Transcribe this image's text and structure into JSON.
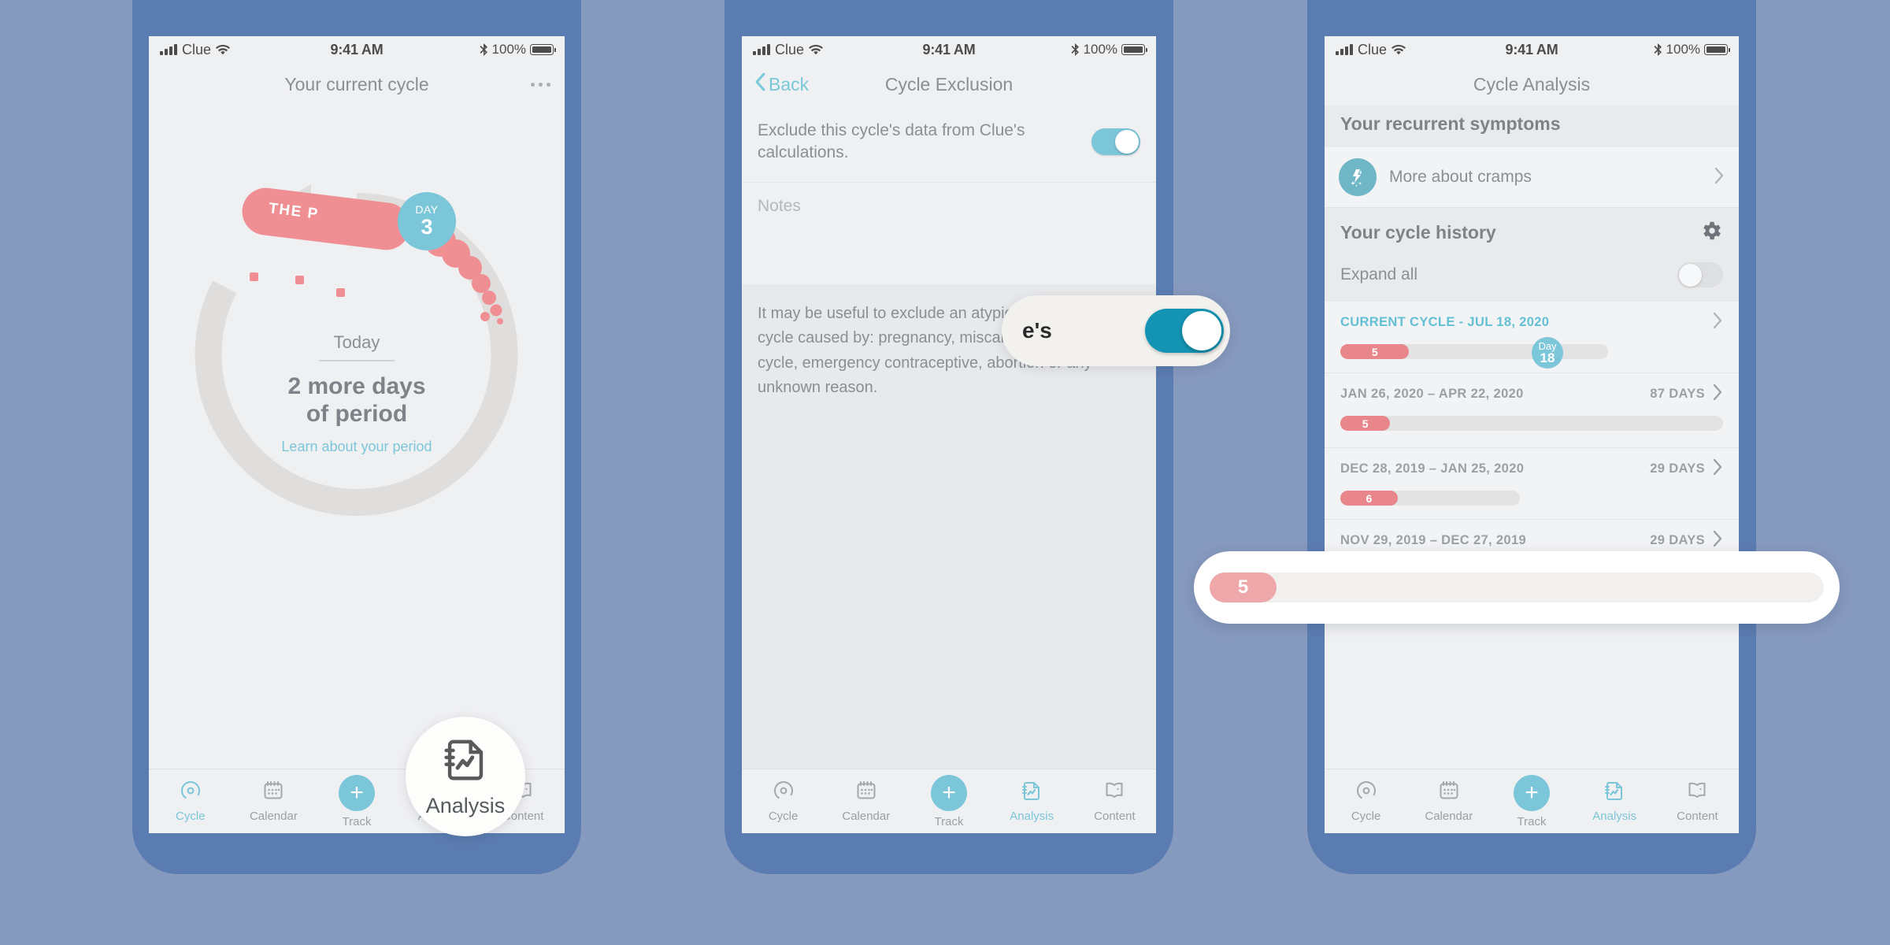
{
  "theme": {
    "background": "#8699be",
    "phone_frame": "#5b7cb0",
    "screen_bg": "#eff0f2",
    "accent_teal": "#7cc6d9",
    "accent_teal_dark": "#1494b4",
    "period_pink": "#e8868c",
    "text_grey": "#8a8f94"
  },
  "status_bar": {
    "carrier": "Clue",
    "time": "9:41 AM",
    "battery_percent": "100%",
    "signal_icon": "signal-bars-icon",
    "wifi_icon": "wifi-icon",
    "bluetooth_icon": "bluetooth-icon",
    "battery_icon": "battery-full-icon"
  },
  "tabbar": {
    "items": [
      {
        "label": "Cycle",
        "icon": "cycle-icon",
        "active_p1": true,
        "active_p2": false,
        "active_p3": false
      },
      {
        "label": "Calendar",
        "icon": "calendar-icon",
        "active_p1": false,
        "active_p2": false,
        "active_p3": false
      },
      {
        "label": "Track",
        "icon": "plus-icon",
        "active_p1": false,
        "active_p2": false,
        "active_p3": false
      },
      {
        "label": "Analysis",
        "icon": "analysis-icon",
        "active_p1": false,
        "active_p2": true,
        "active_p3": true
      },
      {
        "label": "Content",
        "icon": "content-icon",
        "active_p1": false,
        "active_p2": false,
        "active_p3": false
      }
    ]
  },
  "phone1": {
    "nav_title": "Your current cycle",
    "more_icon": "more-options-icon",
    "ring": {
      "pill_text": "THE P",
      "day_label": "DAY",
      "day_number": "3",
      "arrow_icon": "cycle-arrow-icon"
    },
    "today_label": "Today",
    "headline_line1": "2 more days",
    "headline_line2": "of period",
    "learn_link": "Learn about your period",
    "magnifier": {
      "label": "Analysis",
      "icon": "analysis-icon"
    }
  },
  "phone2": {
    "back_label": "Back",
    "nav_title": "Cycle Exclusion",
    "exclude_text": "Exclude this cycle's data from Clue's calculations.",
    "exclude_toggle_state": "on",
    "notes_placeholder": "Notes",
    "description": "It may be useful to exclude an atypically long or short cycle caused by: pregnancy, miscarriage, skipped cycle, emergency contraceptive, abortion or any unknown reason.",
    "magnifier": {
      "text_fragment": "e's",
      "toggle_state": "on"
    }
  },
  "phone3": {
    "nav_title": "Cycle Analysis",
    "symptoms_heading": "Your recurrent symptoms",
    "symptom_row": {
      "icon": "cramps-icon",
      "label": "More about cramps",
      "chevron": "chevron-right-icon"
    },
    "history_heading": "Your cycle history",
    "settings_icon": "gear-icon",
    "expand_all_label": "Expand all",
    "expand_all_state": "off",
    "cycles": [
      {
        "dates": "CURRENT CYCLE - JUL 18, 2020",
        "days": "",
        "current": true,
        "period_days": "5",
        "day_bubble_label": "Day",
        "day_bubble_number": "18",
        "track_width_pct": 70,
        "period_width_pct": 26,
        "bubble_left_pct": 52
      },
      {
        "dates": "JAN 26, 2020 – APR 22, 2020",
        "days": "87 DAYS",
        "current": false,
        "period_days": "5",
        "track_width_pct": 100,
        "period_width_pct": 13
      },
      {
        "dates": "DEC 28, 2019 – JAN 25, 2020",
        "days": "29 DAYS",
        "current": false,
        "period_days": "6",
        "track_width_pct": 47,
        "period_width_pct": 15
      },
      {
        "dates": "NOV 29, 2019 – DEC 27, 2019",
        "days": "29 DAYS",
        "current": false,
        "period_days": "",
        "track_width_pct": 0,
        "period_width_pct": 0
      }
    ],
    "magnifier_bar": {
      "period_days": "5"
    }
  }
}
